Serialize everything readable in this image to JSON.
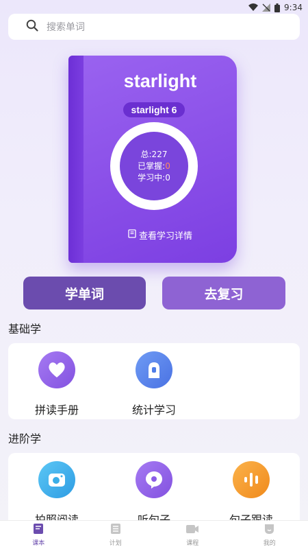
{
  "status": {
    "time": "9:34"
  },
  "search": {
    "placeholder": "搜索单词"
  },
  "book": {
    "title": "starlight",
    "badge": "starlight 6",
    "total": "总:227",
    "mastered_label": "已掌握:",
    "mastered_value": "0",
    "learning": "学习中:0",
    "detail_link": "查看学习详情"
  },
  "actions": {
    "learn": "学单词",
    "review": "去复习"
  },
  "basic": {
    "title": "基础学",
    "items": [
      {
        "label": "拼读手册",
        "icon": "heart-icon",
        "color": "#8b5ce6"
      },
      {
        "label": "统计学习",
        "icon": "chart-icon",
        "color": "#4f7de8"
      }
    ]
  },
  "advanced": {
    "title": "进阶学",
    "items": [
      {
        "label": "拍照阅读",
        "icon": "camera-icon",
        "color": "#3aaee8"
      },
      {
        "label": "听句子",
        "icon": "chat-icon",
        "color": "#8b5ce6"
      },
      {
        "label": "句子跟读",
        "icon": "soundwave-icon",
        "color": "#f59a2b"
      }
    ]
  },
  "tabs": [
    {
      "label": "课本",
      "icon": "book-icon",
      "active": true
    },
    {
      "label": "计划",
      "icon": "list-icon",
      "active": false
    },
    {
      "label": "课程",
      "icon": "video-icon",
      "active": false
    },
    {
      "label": "我的",
      "icon": "profile-icon",
      "active": false
    }
  ],
  "colors": {
    "accent": "#6b4cae",
    "book": "#8a4fe8",
    "highlight": "#ff8a5c"
  }
}
